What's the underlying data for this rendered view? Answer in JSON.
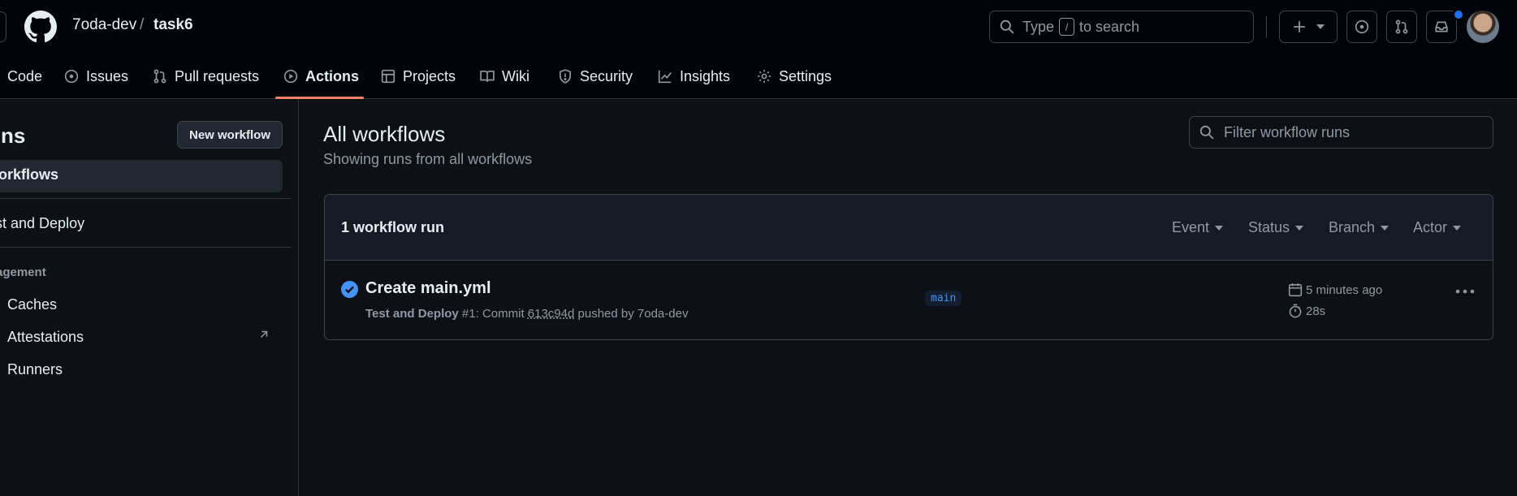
{
  "header": {
    "owner": "7oda-dev",
    "separator": "/",
    "repo": "task6",
    "search": {
      "prefix": "Type",
      "key": "/",
      "suffix": "to search"
    },
    "notification_color": "#1f6feb"
  },
  "tabs": [
    {
      "label": "Code",
      "icon": "code-icon"
    },
    {
      "label": "Issues",
      "icon": "issue-icon"
    },
    {
      "label": "Pull requests",
      "icon": "pull-request-icon"
    },
    {
      "label": "Actions",
      "icon": "play-icon",
      "selected": true
    },
    {
      "label": "Projects",
      "icon": "table-icon"
    },
    {
      "label": "Wiki",
      "icon": "book-icon"
    },
    {
      "label": "Security",
      "icon": "shield-icon"
    },
    {
      "label": "Insights",
      "icon": "graph-icon"
    },
    {
      "label": "Settings",
      "icon": "gear-icon"
    }
  ],
  "sidebar": {
    "title": "Actions",
    "new_workflow": "New workflow",
    "all_workflows": "All workflows",
    "workflow": "Test and Deploy",
    "management_heading": "Management",
    "management_items": [
      "Caches",
      "Attestations",
      "Runners"
    ]
  },
  "main": {
    "title": "All workflows",
    "subtitle": "Showing runs from all workflows",
    "filter_placeholder": "Filter workflow runs",
    "runs_count": "1 workflow run",
    "filters": [
      "Event",
      "Status",
      "Branch",
      "Actor"
    ],
    "run": {
      "title": "Create main.yml",
      "workflow": "Test and Deploy",
      "number": "#1",
      "commit_prefix": ": Commit",
      "sha": "613c94d",
      "pushed_by": "pushed by 7oda-dev",
      "branch": "main",
      "time_ago": "5 minutes ago",
      "duration": "28s",
      "status_color": "#4493f8"
    }
  }
}
